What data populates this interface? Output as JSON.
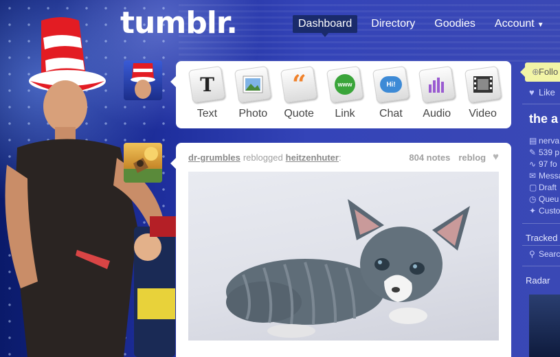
{
  "header": {
    "logo": "tumblr.",
    "nav": [
      {
        "label": "Dashboard",
        "active": true
      },
      {
        "label": "Directory",
        "active": false
      },
      {
        "label": "Goodies",
        "active": false
      },
      {
        "label": "Account",
        "active": false
      }
    ]
  },
  "composer": {
    "post_types": [
      {
        "label": "Text",
        "icon": "text-icon"
      },
      {
        "label": "Photo",
        "icon": "photo-icon"
      },
      {
        "label": "Quote",
        "icon": "quote-icon"
      },
      {
        "label": "Link",
        "icon": "link-icon"
      },
      {
        "label": "Chat",
        "icon": "chat-icon"
      },
      {
        "label": "Audio",
        "icon": "audio-icon"
      },
      {
        "label": "Video",
        "icon": "video-icon"
      }
    ],
    "link_badge": "www",
    "chat_badge": "Hi!"
  },
  "post": {
    "user": "dr-grumbles",
    "verb": "reblogged",
    "source": "heitzenhuter",
    "source_suffix": ":",
    "notes": "804 notes",
    "reblog_label": "reblog"
  },
  "sidebar": {
    "follow_label": "Follo",
    "like_label": "Like",
    "blog_title": "the a",
    "items": [
      {
        "icon": "document-icon",
        "label": "nerva"
      },
      {
        "icon": "edit-icon",
        "label": "539 p"
      },
      {
        "icon": "activity-icon",
        "label": "97 fo"
      },
      {
        "icon": "mail-icon",
        "label": "Messa"
      },
      {
        "icon": "drafts-icon",
        "label": "Draft"
      },
      {
        "icon": "clock-icon",
        "label": "Queu"
      },
      {
        "icon": "wrench-icon",
        "label": "Custo"
      }
    ],
    "tracked_label": "Tracked",
    "search_label": "Searc",
    "radar_label": "Radar"
  },
  "colors": {
    "background": "#2b3bb0",
    "nav_active": "#1a2b6b",
    "follow_bg": "#f2f4a6",
    "card": "#ffffff"
  }
}
